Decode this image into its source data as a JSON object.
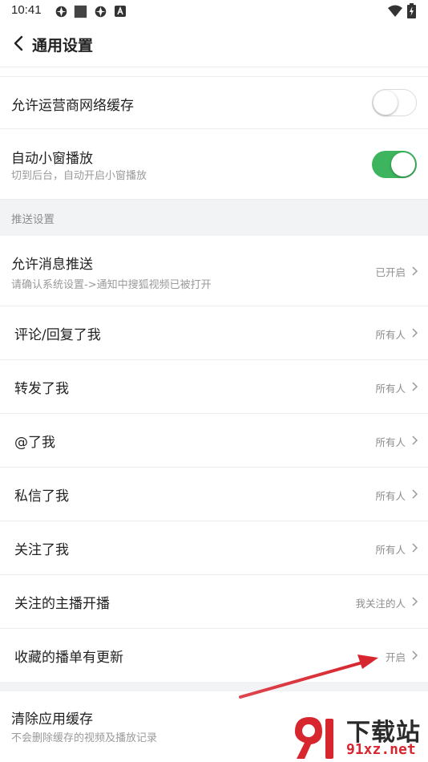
{
  "status_bar": {
    "time": "10:41",
    "icons": [
      "settings-circle-icon",
      "square-app-icon",
      "settings-circle-icon",
      "a-badge-icon"
    ],
    "right_icons": [
      "wifi-icon",
      "battery-icon"
    ]
  },
  "header": {
    "title": "通用设置"
  },
  "rows": {
    "carrier_cache": {
      "label": "允许运营商网络缓存",
      "enabled": false
    },
    "mini_window": {
      "label": "自动小窗播放",
      "sub": "切到后台，自动开启小窗播放",
      "enabled": true
    },
    "push_section_title": "推送设置",
    "allow_push": {
      "label": "允许消息推送",
      "sub": "请确认系统设置->通知中搜狐视频已被打开",
      "value": "已开启"
    },
    "comment_reply": {
      "label": "评论/回复了我",
      "value": "所有人"
    },
    "forwarded": {
      "label": "转发了我",
      "value": "所有人"
    },
    "mentioned": {
      "label": "@了我",
      "value": "所有人"
    },
    "private_msg": {
      "label": "私信了我",
      "value": "所有人"
    },
    "followed": {
      "label": "关注了我",
      "value": "所有人"
    },
    "anchor_live": {
      "label": "关注的主播开播",
      "value": "我关注的人"
    },
    "playlist_update": {
      "label": "收藏的播单有更新",
      "value": "开启"
    },
    "clear_cache": {
      "label": "清除应用缓存",
      "sub": "不会删除缓存的视频及播放记录"
    }
  },
  "watermark": {
    "brand": "下载站",
    "url": "91xz.net"
  },
  "colors": {
    "toggle_on": "#3cb55e",
    "section_bg": "#f2f3f5",
    "annotation_arrow": "#d8262f"
  }
}
